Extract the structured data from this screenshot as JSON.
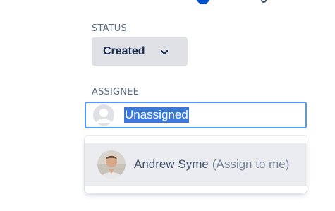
{
  "status": {
    "label": "STATUS",
    "value": "Created"
  },
  "assignee": {
    "label": "ASSIGNEE",
    "value": "Unassigned"
  },
  "dropdown": {
    "option": {
      "name": "Andrew Syme",
      "hint": "(Assign to me)"
    }
  },
  "colors": {
    "focus_border": "#4c9aff",
    "selection": "#3c78d8",
    "status_bg": "#dfe1e6",
    "option_hover": "#ebecf0"
  },
  "icons": {
    "top_avatar": "user-avatar-icon",
    "top_share": "share-icon",
    "status_chevron": "chevron-down-icon",
    "assignee_avatar": "default-user-icon",
    "option_avatar": "user-photo-icon"
  }
}
